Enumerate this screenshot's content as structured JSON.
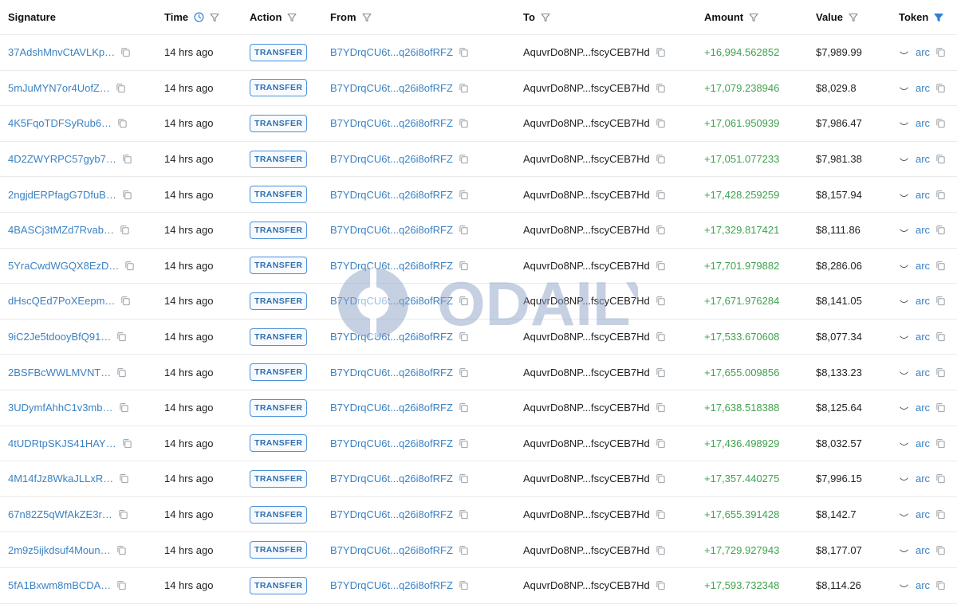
{
  "columns": {
    "signature": "Signature",
    "time": "Time",
    "action": "Action",
    "from": "From",
    "to": "To",
    "amount": "Amount",
    "value": "Value",
    "token": "Token"
  },
  "watermark": "ODAILY",
  "rows": [
    {
      "signature": "37AdshMnvCtAVLKp…",
      "time": "14 hrs ago",
      "action": "TRANSFER",
      "from": "B7YDrqCU6t...q26i8ofRFZ",
      "to": "AquvrDo8NP...fscyCEB7Hd",
      "amount": "+16,994.562852",
      "value": "$7,989.99",
      "token": "arc"
    },
    {
      "signature": "5mJuMYN7or4UofZ…",
      "time": "14 hrs ago",
      "action": "TRANSFER",
      "from": "B7YDrqCU6t...q26i8ofRFZ",
      "to": "AquvrDo8NP...fscyCEB7Hd",
      "amount": "+17,079.238946",
      "value": "$8,029.8",
      "token": "arc"
    },
    {
      "signature": "4K5FqoTDFSyRub6…",
      "time": "14 hrs ago",
      "action": "TRANSFER",
      "from": "B7YDrqCU6t...q26i8ofRFZ",
      "to": "AquvrDo8NP...fscyCEB7Hd",
      "amount": "+17,061.950939",
      "value": "$7,986.47",
      "token": "arc"
    },
    {
      "signature": "4D2ZWYRPC57gyb7…",
      "time": "14 hrs ago",
      "action": "TRANSFER",
      "from": "B7YDrqCU6t...q26i8ofRFZ",
      "to": "AquvrDo8NP...fscyCEB7Hd",
      "amount": "+17,051.077233",
      "value": "$7,981.38",
      "token": "arc"
    },
    {
      "signature": "2ngjdERPfagG7DfuB…",
      "time": "14 hrs ago",
      "action": "TRANSFER",
      "from": "B7YDrqCU6t...q26i8ofRFZ",
      "to": "AquvrDo8NP...fscyCEB7Hd",
      "amount": "+17,428.259259",
      "value": "$8,157.94",
      "token": "arc"
    },
    {
      "signature": "4BASCj3tMZd7Rvab…",
      "time": "14 hrs ago",
      "action": "TRANSFER",
      "from": "B7YDrqCU6t...q26i8ofRFZ",
      "to": "AquvrDo8NP...fscyCEB7Hd",
      "amount": "+17,329.817421",
      "value": "$8,111.86",
      "token": "arc"
    },
    {
      "signature": "5YraCwdWGQX8EzD…",
      "time": "14 hrs ago",
      "action": "TRANSFER",
      "from": "B7YDrqCU6t...q26i8ofRFZ",
      "to": "AquvrDo8NP...fscyCEB7Hd",
      "amount": "+17,701.979882",
      "value": "$8,286.06",
      "token": "arc"
    },
    {
      "signature": "dHscQEd7PoXEepm…",
      "time": "14 hrs ago",
      "action": "TRANSFER",
      "from": "B7YDrqCU6t...q26i8ofRFZ",
      "to": "AquvrDo8NP...fscyCEB7Hd",
      "amount": "+17,671.976284",
      "value": "$8,141.05",
      "token": "arc"
    },
    {
      "signature": "9iC2Je5tdooyBfQ91…",
      "time": "14 hrs ago",
      "action": "TRANSFER",
      "from": "B7YDrqCU6t...q26i8ofRFZ",
      "to": "AquvrDo8NP...fscyCEB7Hd",
      "amount": "+17,533.670608",
      "value": "$8,077.34",
      "token": "arc"
    },
    {
      "signature": "2BSFBcWWLMVNT…",
      "time": "14 hrs ago",
      "action": "TRANSFER",
      "from": "B7YDrqCU6t...q26i8ofRFZ",
      "to": "AquvrDo8NP...fscyCEB7Hd",
      "amount": "+17,655.009856",
      "value": "$8,133.23",
      "token": "arc"
    },
    {
      "signature": "3UDymfAhhC1v3mb…",
      "time": "14 hrs ago",
      "action": "TRANSFER",
      "from": "B7YDrqCU6t...q26i8ofRFZ",
      "to": "AquvrDo8NP...fscyCEB7Hd",
      "amount": "+17,638.518388",
      "value": "$8,125.64",
      "token": "arc"
    },
    {
      "signature": "4tUDRtpSKJS41HAY…",
      "time": "14 hrs ago",
      "action": "TRANSFER",
      "from": "B7YDrqCU6t...q26i8ofRFZ",
      "to": "AquvrDo8NP...fscyCEB7Hd",
      "amount": "+17,436.498929",
      "value": "$8,032.57",
      "token": "arc"
    },
    {
      "signature": "4M14fJz8WkaJLLxR…",
      "time": "14 hrs ago",
      "action": "TRANSFER",
      "from": "B7YDrqCU6t...q26i8ofRFZ",
      "to": "AquvrDo8NP...fscyCEB7Hd",
      "amount": "+17,357.440275",
      "value": "$7,996.15",
      "token": "arc"
    },
    {
      "signature": "67n82Z5qWfAkZE3r…",
      "time": "14 hrs ago",
      "action": "TRANSFER",
      "from": "B7YDrqCU6t...q26i8ofRFZ",
      "to": "AquvrDo8NP...fscyCEB7Hd",
      "amount": "+17,655.391428",
      "value": "$8,142.7",
      "token": "arc"
    },
    {
      "signature": "2m9z5ijkdsuf4Moun…",
      "time": "14 hrs ago",
      "action": "TRANSFER",
      "from": "B7YDrqCU6t...q26i8ofRFZ",
      "to": "AquvrDo8NP...fscyCEB7Hd",
      "amount": "+17,729.927943",
      "value": "$8,177.07",
      "token": "arc"
    },
    {
      "signature": "5fA1Bxwm8mBCDA…",
      "time": "14 hrs ago",
      "action": "TRANSFER",
      "from": "B7YDrqCU6t...q26i8ofRFZ",
      "to": "AquvrDo8NP...fscyCEB7Hd",
      "amount": "+17,593.732348",
      "value": "$8,114.26",
      "token": "arc"
    }
  ]
}
